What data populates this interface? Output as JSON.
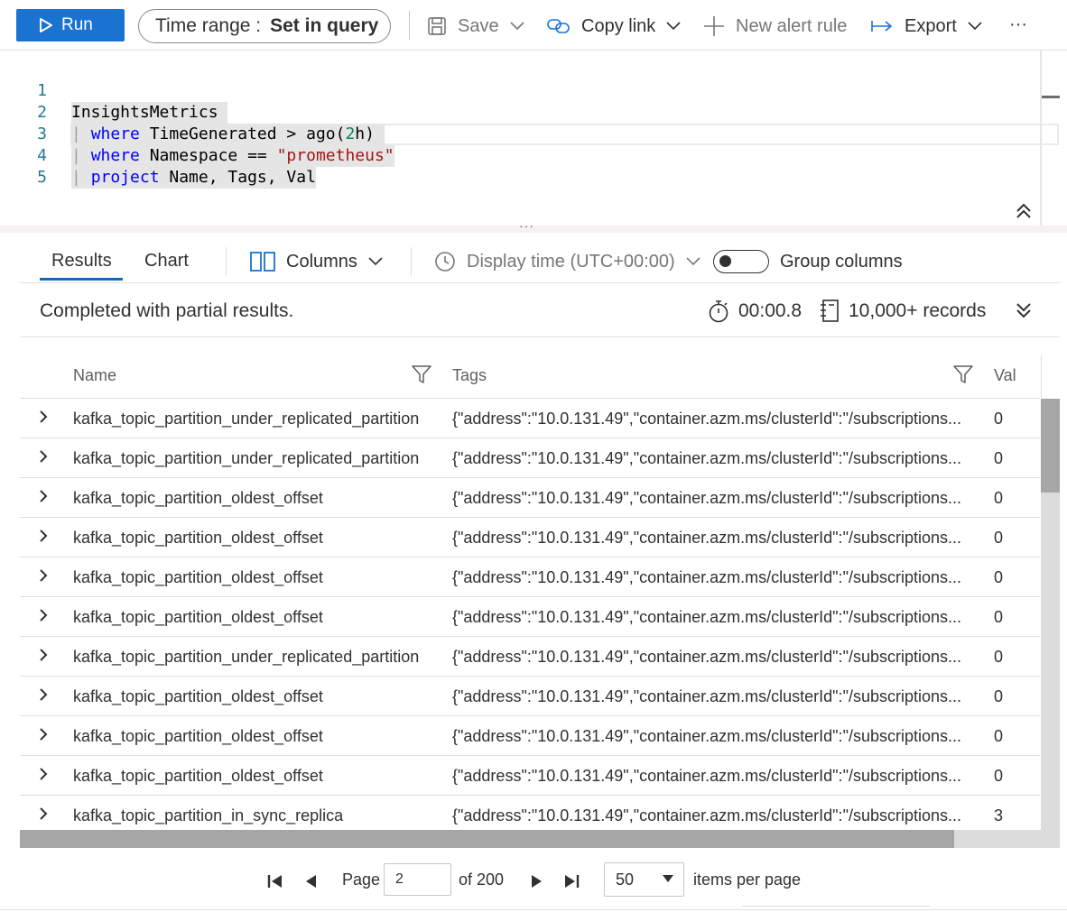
{
  "toolbar": {
    "run_label": "Run",
    "time_range_label": "Time range :",
    "time_range_value": "Set in query",
    "save_label": "Save",
    "copy_link_label": "Copy link",
    "new_alert_label": "New alert rule",
    "export_label": "Export",
    "more_label": "···"
  },
  "editor": {
    "line_numbers": [
      "1",
      "2",
      "3",
      "4",
      "5"
    ],
    "line1": {
      "text": "InsightsMetrics "
    },
    "line2": {
      "pipe": "| ",
      "kw": "where",
      "mid": " TimeGenerated > ago(",
      "num": "2",
      "tail": "h) "
    },
    "line3": {
      "pipe": "| ",
      "kw": "where",
      "mid": " Namespace == ",
      "str": "\"prometheus\""
    },
    "line4": {
      "pipe": "| ",
      "kw": "project",
      "mid": " Name, Tags, Val"
    },
    "splitter_dots": "···"
  },
  "tabs": {
    "results_label": "Results",
    "chart_label": "Chart",
    "columns_label": "Columns",
    "display_time_label": "Display time (UTC+00:00)",
    "group_columns_label": "Group columns",
    "group_columns_on": false
  },
  "status": {
    "message": "Completed with partial results.",
    "duration": "00:00.8",
    "records": "10,000+ records"
  },
  "grid": {
    "headers": {
      "name": "Name",
      "tags": "Tags",
      "val": "Val"
    },
    "rows": [
      {
        "name": "kafka_topic_partition_under_replicated_partition",
        "tags": "{\"address\":\"10.0.131.49\",\"container.azm.ms/clusterId\":\"/subscriptions...",
        "val": "0"
      },
      {
        "name": "kafka_topic_partition_under_replicated_partition",
        "tags": "{\"address\":\"10.0.131.49\",\"container.azm.ms/clusterId\":\"/subscriptions...",
        "val": "0"
      },
      {
        "name": "kafka_topic_partition_oldest_offset",
        "tags": "{\"address\":\"10.0.131.49\",\"container.azm.ms/clusterId\":\"/subscriptions...",
        "val": "0"
      },
      {
        "name": "kafka_topic_partition_oldest_offset",
        "tags": "{\"address\":\"10.0.131.49\",\"container.azm.ms/clusterId\":\"/subscriptions...",
        "val": "0"
      },
      {
        "name": "kafka_topic_partition_oldest_offset",
        "tags": "{\"address\":\"10.0.131.49\",\"container.azm.ms/clusterId\":\"/subscriptions...",
        "val": "0"
      },
      {
        "name": "kafka_topic_partition_oldest_offset",
        "tags": "{\"address\":\"10.0.131.49\",\"container.azm.ms/clusterId\":\"/subscriptions...",
        "val": "0"
      },
      {
        "name": "kafka_topic_partition_under_replicated_partition",
        "tags": "{\"address\":\"10.0.131.49\",\"container.azm.ms/clusterId\":\"/subscriptions...",
        "val": "0"
      },
      {
        "name": "kafka_topic_partition_oldest_offset",
        "tags": "{\"address\":\"10.0.131.49\",\"container.azm.ms/clusterId\":\"/subscriptions...",
        "val": "0"
      },
      {
        "name": "kafka_topic_partition_oldest_offset",
        "tags": "{\"address\":\"10.0.131.49\",\"container.azm.ms/clusterId\":\"/subscriptions...",
        "val": "0"
      },
      {
        "name": "kafka_topic_partition_oldest_offset",
        "tags": "{\"address\":\"10.0.131.49\",\"container.azm.ms/clusterId\":\"/subscriptions...",
        "val": "0"
      },
      {
        "name": "kafka_topic_partition_in_sync_replica",
        "tags": "{\"address\":\"10.0.131.49\",\"container.azm.ms/clusterId\":\"/subscriptions...",
        "val": "3"
      }
    ]
  },
  "pager": {
    "page_label": "Page",
    "current_page": "2",
    "of_label": "of 200",
    "per_page_value": "50",
    "per_page_label": "items per page"
  },
  "icons": {
    "run": "play-icon",
    "save": "floppy-disk-icon",
    "copy_link": "link-icon",
    "new_alert": "plus-icon",
    "export": "arrow-right-bar-icon",
    "columns": "columns-icon",
    "display_time": "clock-icon",
    "duration": "stopwatch-icon",
    "records": "notebook-icon",
    "filter": "funnel-icon"
  },
  "colors": {
    "accent": "#1a73d0",
    "keyword": "#0000ff",
    "string": "#a31515",
    "number": "#098658",
    "line_number": "#237893"
  }
}
